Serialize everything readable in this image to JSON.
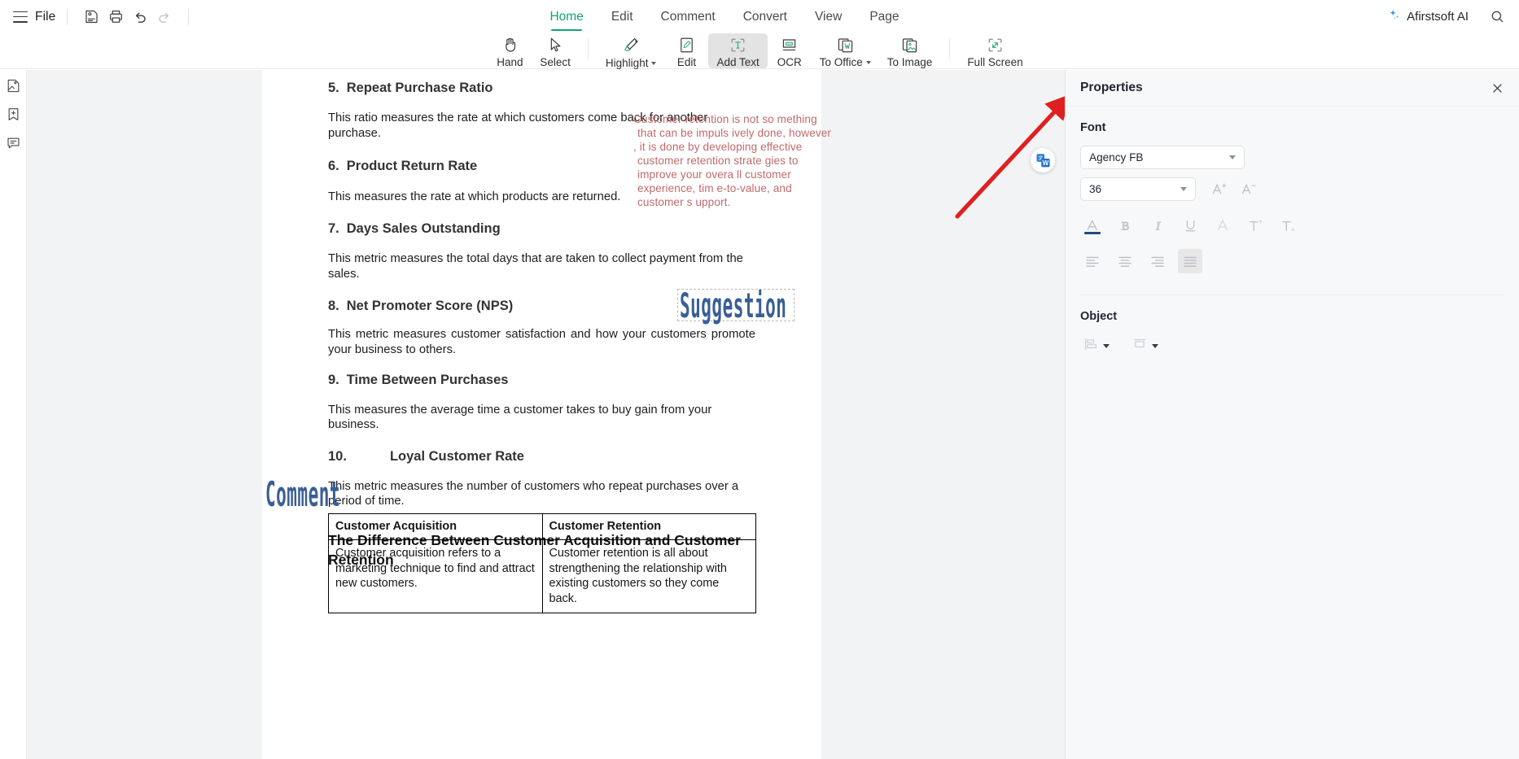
{
  "topbar": {
    "menu_icon": "hamburger-icon",
    "file_label": "File",
    "save_icon": "save-icon",
    "print_icon": "print-icon",
    "undo_icon": "undo-icon",
    "redo_icon": "redo-icon",
    "ai_label": "Afirstsoft AI",
    "ai_icon": "sparkle-icon",
    "search_icon": "search-icon",
    "tabs": [
      {
        "label": "Home",
        "active": true
      },
      {
        "label": "Edit",
        "active": false
      },
      {
        "label": "Comment",
        "active": false
      },
      {
        "label": "Convert",
        "active": false
      },
      {
        "label": "View",
        "active": false
      },
      {
        "label": "Page",
        "active": false
      }
    ],
    "accent_color": "#12a474"
  },
  "ribbon": {
    "items": [
      {
        "label": "Hand",
        "icon": "hand-icon",
        "active": false,
        "caret": false
      },
      {
        "label": "Select",
        "icon": "cursor-arrow-icon",
        "active": false,
        "caret": false
      },
      {
        "label": "Highlight",
        "icon": "highlighter-pen-icon",
        "active": false,
        "caret": true
      },
      {
        "label": "Edit",
        "icon": "edit-page-icon",
        "active": false,
        "caret": false
      },
      {
        "label": "Add Text",
        "icon": "add-text-icon",
        "active": true,
        "caret": false
      },
      {
        "label": "OCR",
        "icon": "ocr-icon",
        "active": false,
        "caret": false
      },
      {
        "label": "To Office",
        "icon": "to-office-word-icon",
        "active": false,
        "caret": true
      },
      {
        "label": "To Image",
        "icon": "to-image-icon",
        "active": false,
        "caret": false
      },
      {
        "label": "Full Screen",
        "icon": "full-screen-icon",
        "active": false,
        "caret": false
      }
    ]
  },
  "leftrail": {
    "items": [
      {
        "icon": "page-thumbnails-icon",
        "name": "sidebar-item-thumbnails"
      },
      {
        "icon": "bookmark-add-icon",
        "name": "sidebar-item-bookmarks"
      },
      {
        "icon": "comment-bubble-icon",
        "name": "sidebar-item-comments"
      }
    ]
  },
  "document": {
    "sections": [
      {
        "num": "5.",
        "title": "Repeat Purchase Ratio",
        "body": "This ratio measures the rate at which customers come back for another purchase.",
        "wide": false,
        "justify": false
      },
      {
        "num": "6.",
        "title": "Product Return Rate",
        "body": "This measures the rate at which products are returned.",
        "wide": false,
        "justify": false
      },
      {
        "num": "7.",
        "title": "Days Sales Outstanding",
        "body": "This metric measures the total days that are taken to collect payment from the sales.",
        "wide": false,
        "justify": false
      },
      {
        "num": "8.",
        "title": "Net Promoter Score (NPS)",
        "body": "This metric measures customer satisfaction and how your customers promote your business to others.",
        "wide": false,
        "justify": true
      },
      {
        "num": "9.",
        "title": "Time Between Purchases",
        "body": "This measures the average time a customer takes to buy gain from your business.",
        "wide": false,
        "justify": false
      },
      {
        "num": "10.",
        "title": "Loyal Customer Rate",
        "body": "This metric measures the number of customers who repeat purchases over a period of time.",
        "wide": true,
        "justify": false
      }
    ],
    "big_heading": "The Difference Between Customer Acquisition and Customer Retention",
    "red_annotation": {
      "color": "#bf6a6c",
      "lines": [
        "Customer retention is not so  mething",
        "that can be impuls  ively done, however",
        ", it is done by developing effective",
        "customer retention strate  gies to",
        "improve your overa  ll customer",
        "experience, tim  e-to-value, and",
        "customer s  upport."
      ]
    },
    "text_boxes": [
      {
        "text": "Suggestion",
        "color": "#3a5e96",
        "selected": true
      },
      {
        "text": "Comment",
        "color": "#3a5e96",
        "selected": false
      }
    ],
    "table": {
      "headers": [
        "Customer Acquisition",
        "Customer Retention"
      ],
      "rows": [
        [
          "Customer acquisition refers to a marketing technique to find and attract new customers.",
          "Customer retention is all about strengthening the relationship with existing customers so they come back."
        ]
      ]
    },
    "float_button": {
      "icon": "translate-word-icon"
    },
    "annotation_arrow": {
      "color": "#e02020",
      "icon": "red-arrow-icon"
    }
  },
  "properties": {
    "title": "Properties",
    "close_icon": "close-icon",
    "font_section_title": "Font",
    "font_family_value": "Agency FB",
    "font_size_value": "36",
    "increase_size_icon": "increase-font-size-icon",
    "decrease_size_icon": "decrease-font-size-icon",
    "format_buttons": [
      {
        "icon": "font-color-icon",
        "label": "A",
        "active": false,
        "color": "#1f4e79"
      },
      {
        "icon": "bold-icon",
        "label": "B",
        "active": false
      },
      {
        "icon": "italic-icon",
        "label": "I",
        "active": false
      },
      {
        "icon": "underline-icon",
        "label": "U",
        "active": false
      },
      {
        "icon": "outline-text-icon",
        "label": "A",
        "active": false
      },
      {
        "icon": "superscript-icon",
        "label": "T",
        "active": false
      },
      {
        "icon": "subscript-icon",
        "label": "T",
        "active": false
      }
    ],
    "align_buttons": [
      {
        "icon": "align-left-icon",
        "active": false
      },
      {
        "icon": "align-center-icon",
        "active": false
      },
      {
        "icon": "align-right-icon",
        "active": false
      },
      {
        "icon": "align-justify-icon",
        "active": true
      }
    ],
    "object_section_title": "Object",
    "object_buttons": [
      {
        "icon": "object-align-icon",
        "caret": true
      },
      {
        "icon": "object-distribute-icon",
        "caret": true
      }
    ]
  }
}
